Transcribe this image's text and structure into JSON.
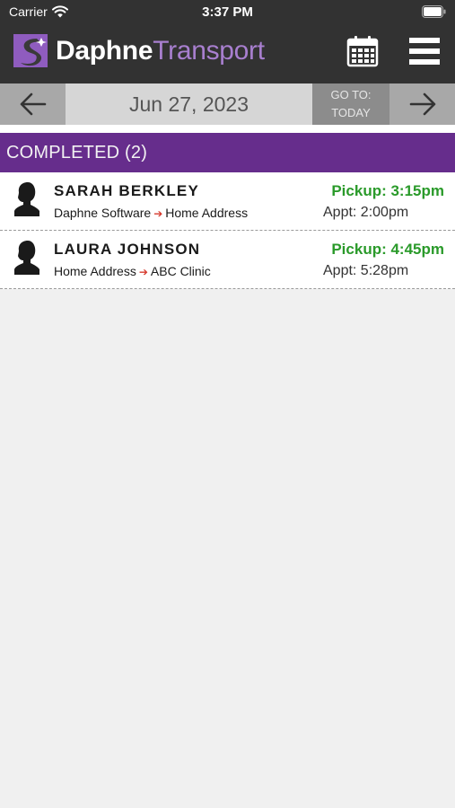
{
  "status_bar": {
    "carrier": "Carrier",
    "time": "3:37 PM"
  },
  "app": {
    "brand_part1": "Daphne",
    "brand_part2": "Transport",
    "header_bg": "#323232",
    "accent": "#662d8c"
  },
  "date_nav": {
    "date": "Jun 27, 2023",
    "goto_line1": "GO TO:",
    "goto_line2": "TODAY",
    "prev_icon": "arrow-left-icon",
    "next_icon": "arrow-right-icon"
  },
  "section": {
    "label": "COMPLETED (2)"
  },
  "trips": [
    {
      "name": "SARAH BERKLEY",
      "origin": "Daphne Software",
      "destination": "Home Address",
      "pickup": "Pickup: 3:15pm",
      "appt": "Appt: 2:00pm"
    },
    {
      "name": "LAURA JOHNSON",
      "origin": "Home Address",
      "destination": "ABC Clinic",
      "pickup": "Pickup: 4:45pm",
      "appt": "Appt: 5:28pm"
    }
  ],
  "colors": {
    "pickup_green": "#2a9a2a",
    "route_arrow_red": "#d63a2e"
  }
}
